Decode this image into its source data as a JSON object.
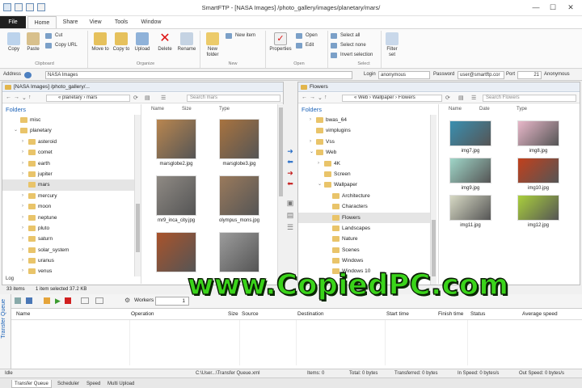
{
  "window": {
    "title": "SmartFTP - [NASA Images] /photo_gallery/images/planetary/mars/",
    "controls": [
      "—",
      "☐",
      "✕"
    ]
  },
  "ribbon_tabs": [
    "File",
    "Home",
    "Share",
    "View",
    "Tools",
    "Window"
  ],
  "ribbon": {
    "clipboard": {
      "copy": "Copy",
      "paste": "Paste",
      "cut": "Cut",
      "copy_url": "Copy URL",
      "group": "Clipboard"
    },
    "organize": {
      "move_to": "Move to",
      "copy_to": "Copy to",
      "upload": "Upload",
      "delete": "Delete",
      "rename": "Rename",
      "group": "Organize"
    },
    "new": {
      "new_folder": "New folder",
      "new_item": "New item",
      "group": "New"
    },
    "open": {
      "properties": "Properties",
      "open": "Open",
      "edit": "Edit",
      "group": "Open"
    },
    "select": {
      "select_all": "Select all",
      "select_none": "Select none",
      "invert": "Invert selection",
      "group": "Select"
    },
    "filter": {
      "filter_set": "Filter set"
    }
  },
  "address_bar": {
    "label": "Address",
    "value": "NASA Images",
    "login_label": "Login",
    "login_value": "anonymous",
    "password_label": "Password",
    "password_value": "user@smartftp.cor",
    "port_label": "Port",
    "port_value": "21",
    "mode_value": "Anonymous"
  },
  "left_pane": {
    "header": "[NASA Images] /photo_gallery/...",
    "path": "« planetary › mars",
    "search_placeholder": "Search mars",
    "folders_label": "Folders",
    "tree": [
      {
        "label": "misc",
        "indent": 1,
        "exp": ""
      },
      {
        "label": "planetary",
        "indent": 1,
        "exp": "v"
      },
      {
        "label": "asteroid",
        "indent": 2,
        "exp": ">"
      },
      {
        "label": "comet",
        "indent": 2,
        "exp": ">"
      },
      {
        "label": "earth",
        "indent": 2,
        "exp": ">"
      },
      {
        "label": "jupiter",
        "indent": 2,
        "exp": ">"
      },
      {
        "label": "mars",
        "indent": 2,
        "exp": "",
        "selected": true
      },
      {
        "label": "mercury",
        "indent": 2,
        "exp": ">"
      },
      {
        "label": "moon",
        "indent": 2,
        "exp": ">"
      },
      {
        "label": "neptune",
        "indent": 2,
        "exp": ">"
      },
      {
        "label": "pluto",
        "indent": 2,
        "exp": ">"
      },
      {
        "label": "saturn",
        "indent": 2,
        "exp": ">"
      },
      {
        "label": "solar_system",
        "indent": 2,
        "exp": ">"
      },
      {
        "label": "uranus",
        "indent": 2,
        "exp": ">"
      },
      {
        "label": "venus",
        "indent": 2,
        "exp": ">"
      }
    ],
    "columns": [
      "Name",
      "Size",
      "Type"
    ],
    "files": [
      {
        "name": "marsglobe2.jpg",
        "color": "#b9864f"
      },
      {
        "name": "marsglobe3.jpg",
        "color": "#a8733f"
      },
      {
        "name": "mr9_inca_city.jpg",
        "color": "#8f8a84"
      },
      {
        "name": "olympus_mons.jpg",
        "color": "#9a7a5c"
      },
      {
        "name": "",
        "color": "#a9532b"
      },
      {
        "name": "",
        "color": "#9c9c9c"
      }
    ],
    "log_label": "Log"
  },
  "left_status": {
    "items": "33 items",
    "selected": "1 item selected 37.2 KB"
  },
  "right_pane": {
    "header": "Flowers",
    "path": "« Web › Wallpaper › Flowers",
    "search_placeholder": "Search Flowers",
    "folders_label": "Folders",
    "tree": [
      {
        "label": "bwas_64",
        "indent": 1,
        "exp": ">"
      },
      {
        "label": "vimplugins",
        "indent": 1,
        "exp": ""
      },
      {
        "label": "Vss",
        "indent": 1,
        "exp": ">"
      },
      {
        "label": "Web",
        "indent": 1,
        "exp": "v"
      },
      {
        "label": "4K",
        "indent": 2,
        "exp": ">"
      },
      {
        "label": "Screen",
        "indent": 2,
        "exp": ""
      },
      {
        "label": "Wallpaper",
        "indent": 2,
        "exp": "v"
      },
      {
        "label": "Architecture",
        "indent": 3,
        "exp": ""
      },
      {
        "label": "Characters",
        "indent": 3,
        "exp": ""
      },
      {
        "label": "Flowers",
        "indent": 3,
        "exp": "",
        "selected": true
      },
      {
        "label": "Landscapes",
        "indent": 3,
        "exp": ""
      },
      {
        "label": "Nature",
        "indent": 3,
        "exp": ""
      },
      {
        "label": "Scenes",
        "indent": 3,
        "exp": ""
      },
      {
        "label": "Windows",
        "indent": 3,
        "exp": ""
      },
      {
        "label": "Windows 10",
        "indent": 3,
        "exp": ""
      }
    ],
    "columns": [
      "Name",
      "Date",
      "Type"
    ],
    "files": [
      {
        "name": "img7.jpg",
        "color": "#3a8fb0"
      },
      {
        "name": "img8.jpg",
        "color": "#e8b7c9"
      },
      {
        "name": "img9.jpg",
        "color": "#9fd6c8"
      },
      {
        "name": "img10.jpg",
        "color": "#c2401c"
      },
      {
        "name": "img11.jpg",
        "color": "#d7d9c4"
      },
      {
        "name": "img12.jpg",
        "color": "#a9cf3c"
      }
    ]
  },
  "queue": {
    "vertical_label": "Transfer Queue",
    "workers_label": "Workers",
    "workers_value": "1",
    "columns": [
      "Name",
      "Operation",
      "Size",
      "Source",
      "Destination",
      "Start time",
      "Finish time",
      "Status",
      "Average speed"
    ]
  },
  "bottom_status": {
    "state": "Idle",
    "file": "C:\\User...\\Transfer Queue.xml",
    "items": "Items: 0",
    "total": "Total: 0 bytes",
    "transferred": "Transferred: 0 bytes",
    "in_speed": "In Speed: 0 bytes/s",
    "out_speed": "Out Speed: 0 bytes/s"
  },
  "bottom_tabs": [
    "Transfer Queue",
    "Scheduler",
    "Speed",
    "Multi Upload"
  ],
  "watermark": "www.CopiedPC.com",
  "colors": {
    "accent": "#1c63b8",
    "folder": "#e9c46a",
    "watermark": "#3ad41a"
  }
}
